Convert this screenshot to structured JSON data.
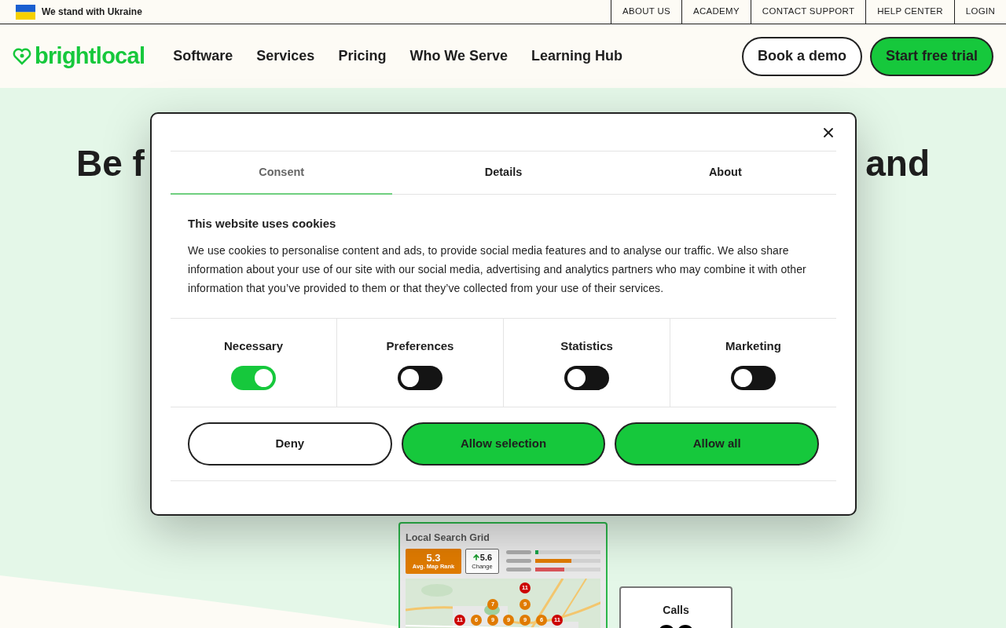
{
  "top_bar": {
    "ukraine": "We stand with Ukraine",
    "links": [
      "ABOUT US",
      "ACADEMY",
      "CONTACT SUPPORT",
      "HELP CENTER",
      "LOGIN"
    ]
  },
  "nav": {
    "logo": "brightlocal",
    "items": [
      "Software",
      "Services",
      "Pricing",
      "Who We Serve",
      "Learning Hub"
    ],
    "demo": "Book a demo",
    "trial": "Start free trial"
  },
  "hero": {
    "headline_left": "Be f",
    "headline_right": "and"
  },
  "grid_card": {
    "title": "Local Search Grid",
    "rank": "5.3",
    "rank_label": "Avg. Map Rank",
    "change": "5.6",
    "change_label": "Change",
    "bars": [
      {
        "level": 0.05,
        "color": "#16a34a"
      },
      {
        "level": 0.55,
        "color": "#e07b00"
      },
      {
        "level": 0.45,
        "color": "#d9545a"
      }
    ],
    "pins": [
      {
        "label": "11",
        "color": "#cc0000"
      },
      {
        "label": "7",
        "color": "#e07b00"
      },
      {
        "label": "9",
        "color": "#e07b00"
      },
      {
        "label": "11",
        "color": "#cc0000"
      },
      {
        "label": "6",
        "color": "#e07b00"
      },
      {
        "label": "9",
        "color": "#e07b00"
      },
      {
        "label": "9",
        "color": "#e07b00"
      },
      {
        "label": "9",
        "color": "#e07b00"
      },
      {
        "label": "6",
        "color": "#e07b00"
      },
      {
        "label": "11",
        "color": "#cc0000"
      }
    ]
  },
  "calls_card": {
    "title": "Calls"
  },
  "cookie_dialog": {
    "tabs": [
      {
        "label": "Consent",
        "selected": true
      },
      {
        "label": "Details",
        "selected": false
      },
      {
        "label": "About",
        "selected": false
      }
    ],
    "heading": "This website uses cookies",
    "body": "We use cookies to personalise content and ads, to provide social media features and to analyse our traffic. We also share information about your use of our site with our social media, advertising and analytics partners who may combine it with other information that you’ve provided to them or that they’ve collected from your use of their services.",
    "toggles": [
      {
        "label": "Necessary",
        "on": true
      },
      {
        "label": "Preferences",
        "on": false
      },
      {
        "label": "Statistics",
        "on": false
      },
      {
        "label": "Marketing",
        "on": false
      }
    ],
    "buttons": [
      {
        "label": "Deny",
        "kind": "outline"
      },
      {
        "label": "Allow selection",
        "kind": "filled"
      },
      {
        "label": "Allow all",
        "kind": "filled"
      }
    ]
  }
}
